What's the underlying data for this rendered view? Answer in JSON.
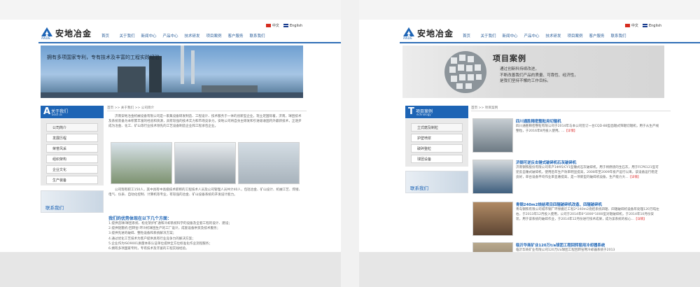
{
  "company": {
    "name": "安地冶金",
    "logo_sub": "ANDE"
  },
  "lang": {
    "cn": "中文",
    "en": "English"
  },
  "nav": [
    "首页",
    "关于我们",
    "新闻中心",
    "产品中心",
    "技术研发",
    "项目案例",
    "客户服务",
    "联系我们"
  ],
  "page_a": {
    "banner_caption": "拥有多项国家专利，专有技术及丰富的工程实践经验",
    "section": {
      "letter": "A",
      "title": "关于我们",
      "en": "bout us"
    },
    "side_items": [
      "公司简介",
      "发展历程",
      "荣誉风采",
      "组织架构",
      "企业文化",
      "生产装备"
    ],
    "contact": "联系我们",
    "breadcrumb": "首页 >> 关于我们 >> 公司简介",
    "intro": "济南安地冶金机械设备有限公司是一家集设备研发制造、工程设计、技术服务于一体的创新型企业，现立足国际着，济南，球团技术及系统装备为本积累丰富的经验和资源，具有较强的技术实力和市场竞争力。安地公司将自身主研发和引进吸收国内外最新技术，正逐步成为冶金、化工、矿山等行业技术领先的工艺设备制造企业和工程承包企业。",
    "staff": "公司现有职工150人，其中具有中高级技术职称的工程技术人员及公司管理人员共计40人，包括冶金、矿山设计、机械工艺、焊接、电气、仪表、自动化控制、计算机等专业，有较强的冶金、矿山设备系统的开发设计能力。",
    "list_title": "我们的优势体现在以下几个方面：",
    "points": [
      "1.提供造球/球团系统、松化架炉扩通和冷却系统科学的设备及全套工程的设计、建设；",
      "2.提供链篦机-回转窑-环冷机球团生产的工厂设计，成套设备供货及技术服务；",
      "3.提供先进的破碎、整粒设备和系统解决方案；",
      "4.通过优化工艺技术为客户提供具有行业竞争力的解决方案；",
      "5.企业作为ISO9001质量体系认证单位提供全方位标准化作业流程服务；",
      "6.拥有多项国家专利，专有技术及丰富的工程实践经验。"
    ]
  },
  "page_b": {
    "banner_title": "项目案例",
    "banner_lines": [
      "通过创新科持续改进，",
      "不断改善我们产品的质量、可靠性、经济性，",
      "是我们坚持不懈的工作目标。"
    ],
    "section": {
      "letter": "T",
      "title": "项目案例",
      "en": "echnology"
    },
    "side_items": [
      "立式磨及制粒",
      "护壁喷浆",
      "破碎整粒",
      "球团设备"
    ],
    "contact": "联系我们",
    "breadcrumb": "首页 >> 项目案例",
    "cases": [
      {
        "title": "四川通胜精密整粒用切辊机",
        "text": "四川通胜精密整粒有限公司于2014年与本公司签订一台CQD-88型齿辊式筛辊切辊机，用于从生产线整粒，于2016年8月投入使用。...",
        "more": "【详情】"
      },
      {
        "title": "济钢可逆反击锤式破碎机石灰破碎机",
        "text": "济南钢铁股份有限公司年产1Φ95/CY1型锤式石灰破碎机，用于将燃烧的生石灰，用于FCP6121型可逆反击锤式破碎机，使用后年生产效率明显提高，2008年至2009年投产运行以来，该设备运行稳定良好，单台设备平均作业率显著提高，是一项新型的破碎机设备，生产能力大...",
        "more": "【详情】"
      },
      {
        "title": "青钢240m2烧结项目四辊破碎机改造、四辊破碎机",
        "text": "青岛钢铁有限公司城市钢厂环保搬迁工程2*240m2烧结系统四辊、四辊破碎机设备年处理120万吨左右，于2013年12月投入使用，公司于2014年6*1000*1000型对辊破碎机，于2014年10月份安装，用于该系统的破碎作业，于2014年12月份进行技术成果，成为该系统的核心...",
        "more": "【详情】"
      },
      {
        "title": "临沂华商矿业120万t/a球团工程回转窑用冷却器系统",
        "text": "临沂华商矿业有限公司120万t/a球团工程回转窑用冷却器系统于2013",
        "more": ""
      }
    ]
  }
}
